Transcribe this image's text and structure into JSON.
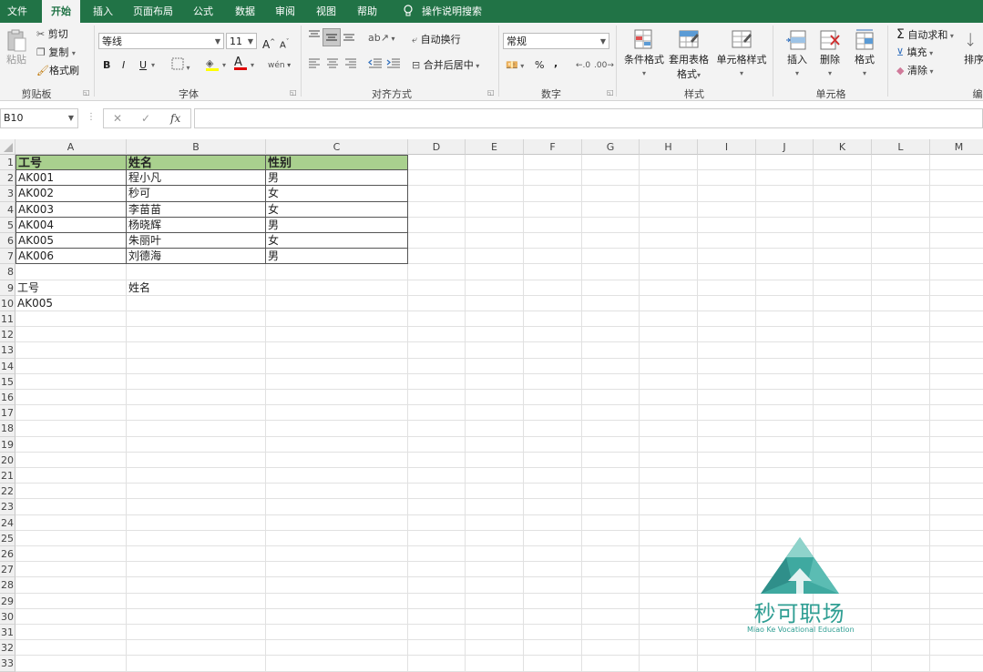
{
  "tabs": [
    "文件",
    "开始",
    "插入",
    "页面布局",
    "公式",
    "数据",
    "审阅",
    "视图",
    "帮助",
    "操作说明搜索"
  ],
  "clipboard": {
    "paste": "粘贴",
    "cut": "剪切",
    "copy": "复制",
    "format_painter": "格式刷",
    "label": "剪贴板"
  },
  "font": {
    "name": "等线",
    "size": "11",
    "label": "字体",
    "bold": "B",
    "italic": "I",
    "underline": "U",
    "grow": "A",
    "shrink": "A"
  },
  "alignment": {
    "wrap": "自动换行",
    "merge": "合并后居中",
    "label": "对齐方式"
  },
  "number": {
    "format": "常规",
    "percent": "%",
    "comma": ",",
    "label": "数字"
  },
  "styles": {
    "conditional": "条件格式",
    "table": "套用表格格式",
    "cell": "单元格样式",
    "label": "样式"
  },
  "cells": {
    "insert": "插入",
    "delete": "删除",
    "format": "格式",
    "label": "单元格"
  },
  "editing": {
    "autosum": "自动求和",
    "fill": "填充",
    "clear": "清除",
    "sort": "排序",
    "label": "编"
  },
  "formula_bar": {
    "name_box": "B10",
    "fx": "fx",
    "cancel": "✕",
    "enter": "✓"
  },
  "columns": [
    "A",
    "B",
    "C",
    "D",
    "E",
    "F",
    "G",
    "H",
    "I",
    "J",
    "K",
    "L",
    "M"
  ],
  "rows": [
    "1",
    "2",
    "3",
    "4",
    "5",
    "6",
    "7",
    "8",
    "9",
    "10",
    "11",
    "12",
    "13",
    "14",
    "15",
    "16",
    "17",
    "18",
    "19",
    "20",
    "21",
    "22",
    "23",
    "24",
    "25",
    "26",
    "27",
    "28",
    "29",
    "30",
    "31",
    "32",
    "33"
  ],
  "table": {
    "headers": [
      "工号",
      "姓名",
      "性别"
    ],
    "rows": [
      [
        "AK001",
        "程小凡",
        "男"
      ],
      [
        "AK002",
        "秒可",
        "女"
      ],
      [
        "AK003",
        "李苗苗",
        "女"
      ],
      [
        "AK004",
        "杨晓辉",
        "男"
      ],
      [
        "AK005",
        "朱丽叶",
        "女"
      ],
      [
        "AK006",
        "刘德海",
        "男"
      ]
    ]
  },
  "lookup": {
    "label_a": "工号",
    "label_b": "姓名",
    "value_a": "AK005"
  },
  "watermark": {
    "name": "秒可职场",
    "subtitle": "Miao Ke Vocational Education"
  },
  "colors": {
    "accent": "#217346",
    "header_fill": "#a9d08e"
  }
}
